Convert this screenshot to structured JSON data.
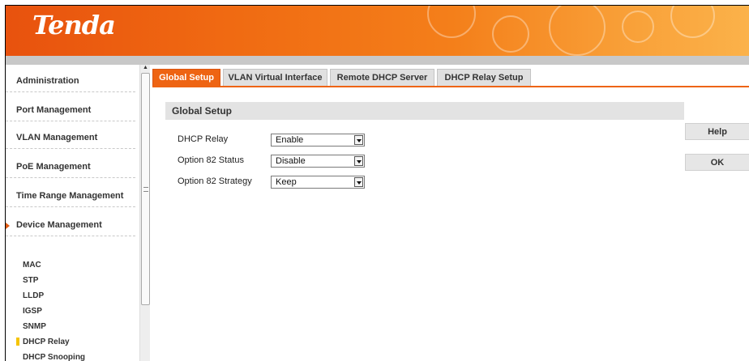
{
  "header": {
    "logo": "Tenda"
  },
  "sidebar": {
    "items": [
      {
        "label": "Administration"
      },
      {
        "label": "Port Management"
      },
      {
        "label": "VLAN Management"
      },
      {
        "label": "PoE Management"
      },
      {
        "label": "Time Range Management"
      },
      {
        "label": "Device Management",
        "expanded": true
      }
    ],
    "subitems": [
      {
        "label": "MAC"
      },
      {
        "label": "STP"
      },
      {
        "label": "LLDP"
      },
      {
        "label": "IGSP"
      },
      {
        "label": "SNMP"
      },
      {
        "label": "DHCP Relay",
        "selected": true
      },
      {
        "label": "DHCP Snooping"
      }
    ]
  },
  "tabs": [
    {
      "label": "Global Setup",
      "active": true
    },
    {
      "label": "VLAN Virtual Interface"
    },
    {
      "label": "Remote DHCP Server"
    },
    {
      "label": "DHCP Relay Setup"
    }
  ],
  "section": {
    "title": "Global Setup"
  },
  "fields": [
    {
      "label": "DHCP Relay",
      "value": "Enable"
    },
    {
      "label": "Option 82 Status",
      "value": "Disable"
    },
    {
      "label": "Option 82 Strategy",
      "value": "Keep"
    }
  ],
  "buttons": {
    "help": "Help",
    "ok": "OK"
  },
  "colors": {
    "accent": "#ee6413",
    "marker": "#f5c400"
  }
}
